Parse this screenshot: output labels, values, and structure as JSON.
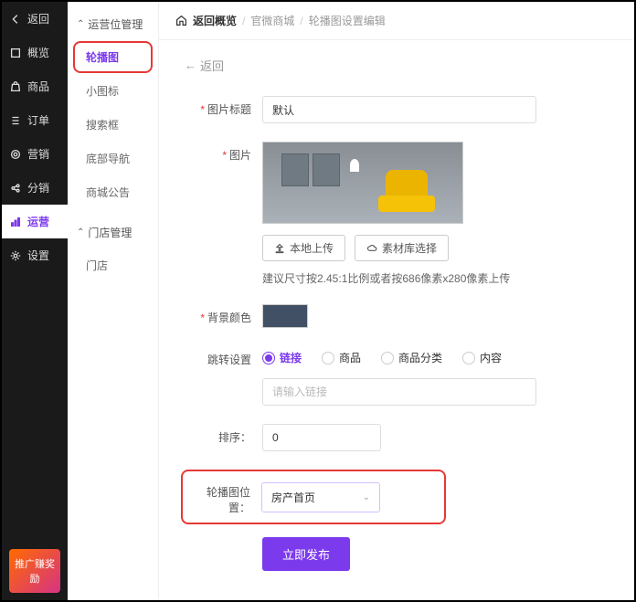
{
  "sidebar": {
    "items": [
      {
        "label": "返回",
        "icon": "arrow-left"
      },
      {
        "label": "概览",
        "icon": "square"
      },
      {
        "label": "商品",
        "icon": "bag"
      },
      {
        "label": "订单",
        "icon": "list"
      },
      {
        "label": "营销",
        "icon": "target"
      },
      {
        "label": "分销",
        "icon": "share"
      },
      {
        "label": "运营",
        "icon": "chart",
        "active": true
      },
      {
        "label": "设置",
        "icon": "gear"
      }
    ],
    "promo": "推广赚奖励"
  },
  "subnav": {
    "group1": {
      "title": "运营位管理",
      "items": [
        "轮播图",
        "小图标",
        "搜索框",
        "底部导航",
        "商城公告"
      ]
    },
    "group2": {
      "title": "门店管理",
      "items": [
        "门店"
      ]
    }
  },
  "breadcrumb": {
    "c1": "返回概览",
    "c2": "官微商城",
    "c3": "轮播图设置编辑"
  },
  "back_link": "返回",
  "form": {
    "title": {
      "label": "图片标题",
      "value": "默认"
    },
    "image": {
      "label": "图片",
      "upload_local": "本地上传",
      "upload_library": "素材库选择",
      "hint": "建议尺寸按2.45:1比例或者按686像素x280像素上传"
    },
    "bgcolor": {
      "label": "背景颜色",
      "value": "#415065"
    },
    "jump": {
      "label": "跳转设置",
      "options": [
        "链接",
        "商品",
        "商品分类",
        "内容"
      ],
      "selected": "链接",
      "link_placeholder": "请输入链接"
    },
    "sort": {
      "label": "排序：",
      "value": "0"
    },
    "position": {
      "label": "轮播图位置：",
      "selected": "房产首页"
    },
    "submit": "立即发布"
  }
}
